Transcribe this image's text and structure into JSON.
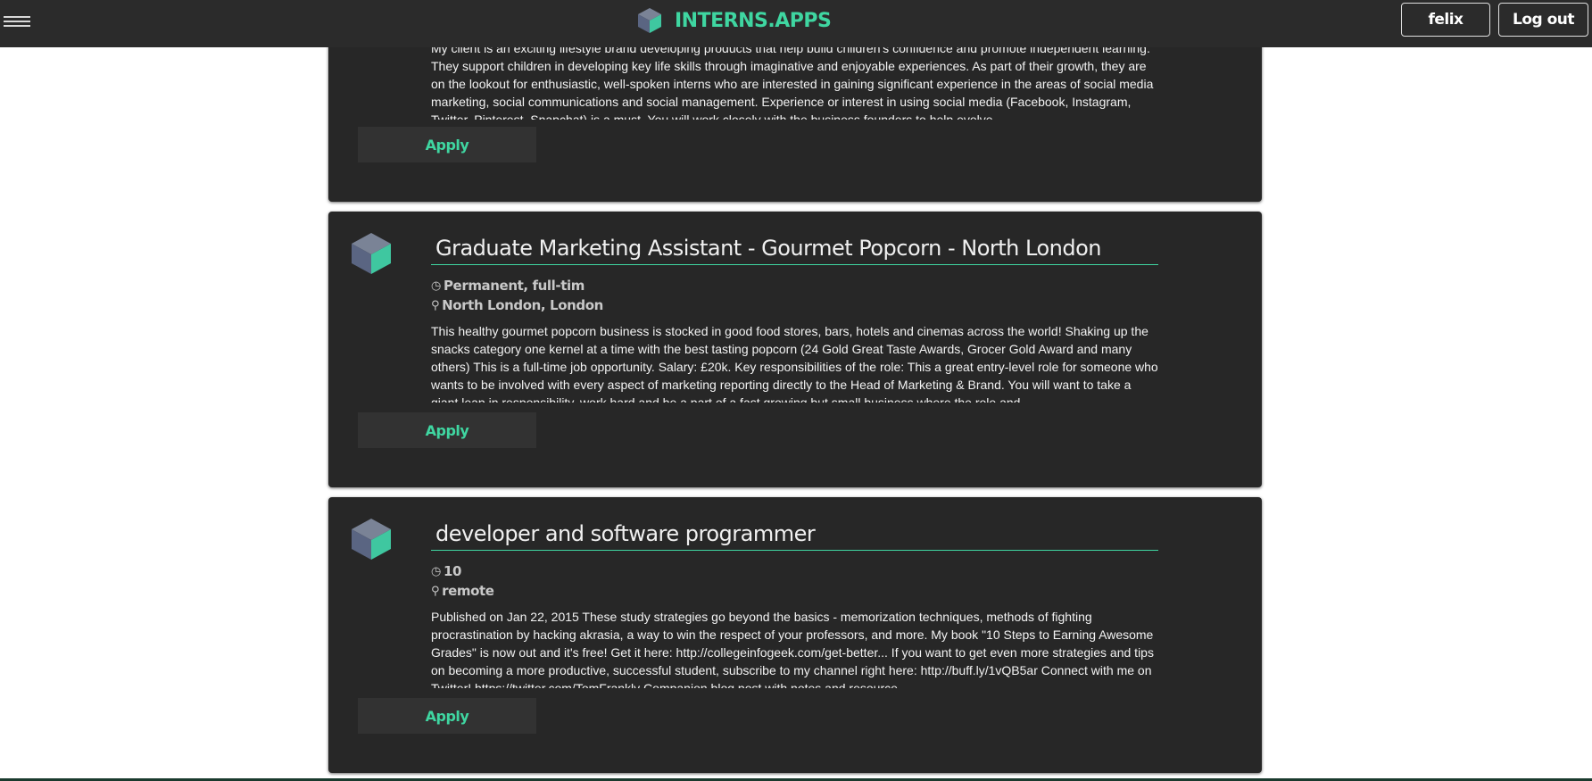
{
  "header": {
    "brand": "INTERNS.APPS",
    "user_label": "felix",
    "logout_label": "Log out"
  },
  "jobs": [
    {
      "title": "",
      "description": "My client is an exciting lifestyle brand developing products that help build children's confidence and promote independent learning. They support children in developing key life skills through imaginative and enjoyable experiences. As part of their growth, they are on the lookout for enthusiastic, well-spoken interns who are interested in gaining significant experience in the areas of social media marketing, social communications and social management. Experience or interest in using social media (Facebook, Instagram, Twitter, Pinterest, Snapchat) is a must. You will work closely with the business founders to help evolve",
      "apply_label": "Apply"
    },
    {
      "title": "Graduate Marketing Assistant - Gourmet Popcorn - North London",
      "type": "Permanent, full-tim",
      "location": "North London, London",
      "description": "This healthy gourmet popcorn business is stocked in good food stores, bars, hotels and cinemas across the world! Shaking up the snacks category one kernel at a time with the best tasting popcorn (24 Gold Great Taste Awards, Grocer Gold Award and many others) This is a full-time job opportunity. Salary: £20k. Key responsibilities of the role: This a great entry-level role for someone who wants to be involved with every aspect of marketing reporting directly to the Head of Marketing & Brand. You will want to take a giant leap in responsibility, work hard and be a part of a fast growing but small business where the role and",
      "apply_label": "Apply"
    },
    {
      "title": "developer and software programmer",
      "type": "10",
      "location": "remote",
      "description": "Published on Jan 22, 2015 These study strategies go beyond the basics - memorization techniques, methods of fighting procrastination by hacking akrasia, a way to win the respect of your professors, and more. My book \"10 Steps to Earning Awesome Grades\" is now out and it's free! Get it here: http://collegeinfogeek.com/get-better... If you want to get even more strategies and tips on becoming a more productive, successful student, subscribe to my channel right here: http://buff.ly/1vQB5ar Connect with me on Twitter! https://twitter.com/TomFrankly Companion blog post with notes and resource",
      "apply_label": "Apply"
    }
  ],
  "colors": {
    "accent": "#3fd6a1",
    "navbar": "#2b2b2b",
    "card": "#272727",
    "button": "#323232"
  },
  "icons": {
    "menu": "hamburger-menu-icon",
    "logo": "cube-logo-icon",
    "job_type": "clock-icon",
    "location": "map-marker-icon"
  }
}
